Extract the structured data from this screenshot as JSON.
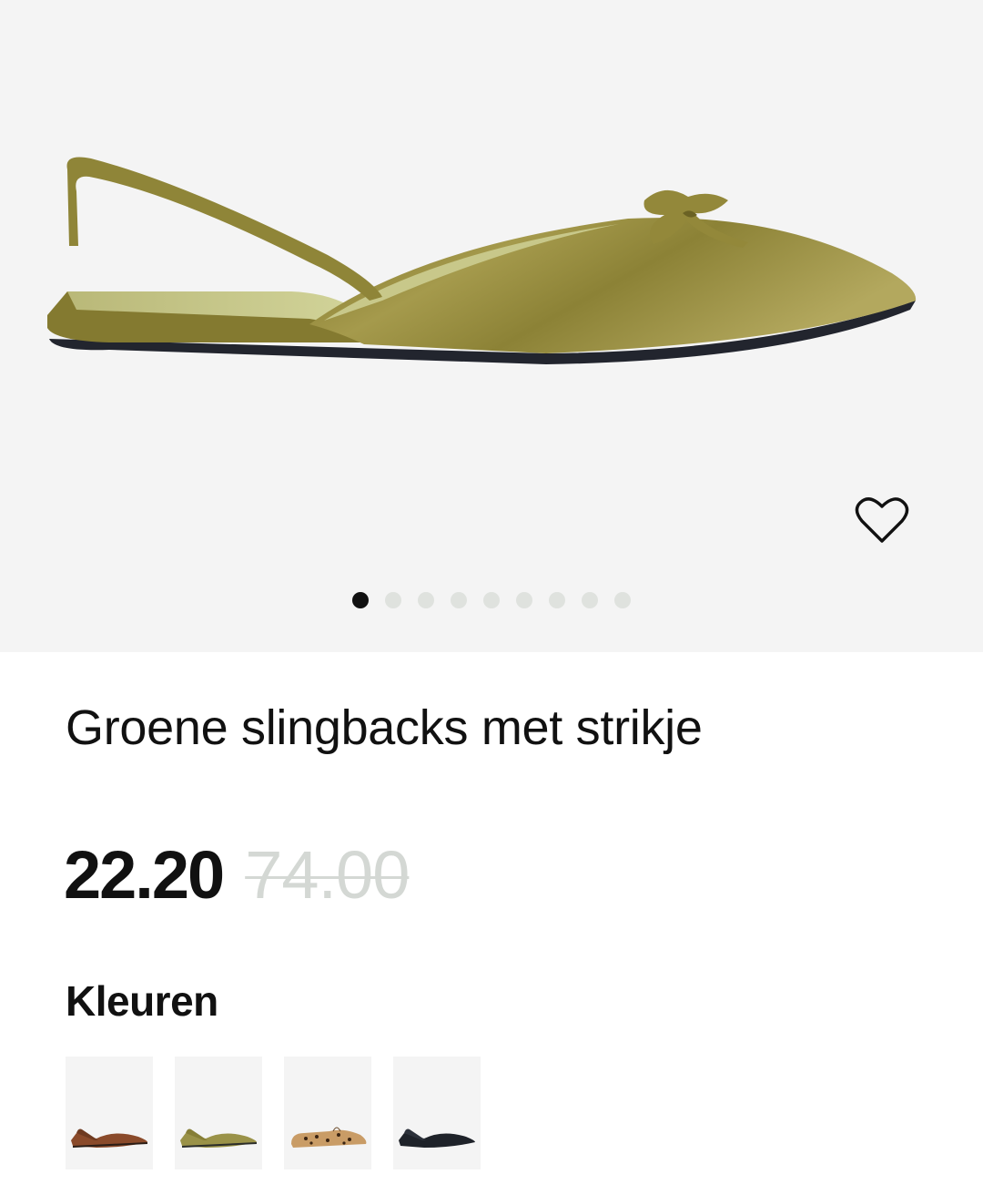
{
  "product": {
    "title": "Groene slingbacks met strikje",
    "price_current": "22.20",
    "price_original": "74.00",
    "main_image_icon": "green-slingback-shoe-image"
  },
  "gallery": {
    "image_count": 9,
    "active_index": 0,
    "favorite_icon": "heart-outline-icon"
  },
  "colors": {
    "heading": "Kleuren",
    "swatches": [
      {
        "name": "brown",
        "color": "#8a4a2a"
      },
      {
        "name": "green",
        "color": "#9a9248"
      },
      {
        "name": "leopard",
        "color": "#c99c66"
      },
      {
        "name": "black",
        "color": "#1e2229"
      }
    ]
  },
  "theme": {
    "background": "#ffffff",
    "gallery_bg": "#f4f4f4",
    "text": "#111111",
    "old_price": "#d4d8d4",
    "dot_inactive": "#dfe2de"
  }
}
